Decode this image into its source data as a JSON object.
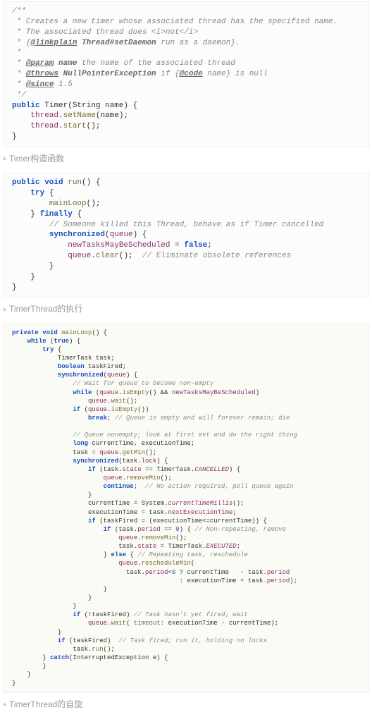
{
  "block1": {
    "jdoc_open": "/**",
    "jdoc_l1": " * Creates a new timer whose associated thread has the specified name.",
    "jdoc_l2_a": " * The associated thread does ",
    "jdoc_l2_b": "<i>",
    "jdoc_l2_c": "not",
    "jdoc_l2_d": "</i>",
    "jdoc_l3_a": " * {",
    "jdoc_l3_tag": "@linkplain",
    "jdoc_l3_ref": " Thread#setDaemon",
    "jdoc_l3_rest": " run as a daemon}.",
    "jdoc_l4": " *",
    "jdoc_l5_a": " * ",
    "jdoc_l5_tag": "@param",
    "jdoc_l5_name": " name",
    "jdoc_l5_rest": " the name of the associated thread",
    "jdoc_l6_a": " * ",
    "jdoc_l6_tag": "@throws",
    "jdoc_l6_name": " NullPointerException",
    "jdoc_l6_rest_a": " if {",
    "jdoc_l6_tag2": "@code",
    "jdoc_l6_rest_b": " name} is null",
    "jdoc_l7_a": " * ",
    "jdoc_l7_tag": "@since",
    "jdoc_l7_rest": " 1.5",
    "jdoc_close": " */",
    "sig_kw": "public",
    "sig_name": " Timer(String name) {",
    "body1_a": "    ",
    "body1_fld": "thread",
    "body1_b": ".",
    "body1_m": "setName",
    "body1_c": "(name);",
    "body2_a": "    ",
    "body2_fld": "thread",
    "body2_b": ".",
    "body2_m": "start",
    "body2_c": "();",
    "close": "}"
  },
  "caption1": "Timer构造函数",
  "block2": {
    "l1_kw1": "public",
    "l1_kw2": " void",
    "l1_name": " run",
    "l1_rest": "() {",
    "l2_kw": "    try",
    "l2_rest": " {",
    "l3_a": "        ",
    "l3_m": "mainLoop",
    "l3_b": "();",
    "l4_a": "    } ",
    "l4_kw": "finally",
    "l4_b": " {",
    "l5_a": "        ",
    "l5_c": "// Someone killed this Thread, behave as if Timer cancelled",
    "l6_a": "        ",
    "l6_kw": "synchronized",
    "l6_b": "(",
    "l6_fld": "queue",
    "l6_c": ") {",
    "l7_a": "            ",
    "l7_fld": "newTasksMayBeScheduled",
    "l7_b": " = ",
    "l7_kw": "false",
    "l7_c": ";",
    "l8_a": "            ",
    "l8_fld": "queue",
    "l8_b": ".",
    "l8_m": "clear",
    "l8_c": "();  ",
    "l8_cmt": "// Eliminate obsolete references",
    "l9": "        }",
    "l10": "    }",
    "l11": "}"
  },
  "caption2": "TimerThread的执行",
  "block3": {
    "l1_kw1": "private",
    "l1_kw2": " void",
    "l1_name": " mainLoop",
    "l1_rest": "() {",
    "l2_kw": "    while",
    "l2_a": " (",
    "l2_kw2": "true",
    "l2_b": ") {",
    "l3_kw": "        try",
    "l3_a": " {",
    "l4": "            TimerTask task;",
    "l5_kw": "            boolean",
    "l5_a": " taskFired;",
    "l6_kw": "            synchronized",
    "l6_a": "(",
    "l6_fld": "queue",
    "l6_b": ") {",
    "l7_a": "                ",
    "l7_c": "// Wait for queue to become non-empty",
    "l8_kw": "                while",
    "l8_a": " (",
    "l8_fld": "queue",
    "l8_b": ".",
    "l8_m": "isEmpty",
    "l8_c": "() && ",
    "l8_fld2": "newTasksMayBeScheduled",
    "l8_d": ")",
    "l9_a": "                    ",
    "l9_fld": "queue",
    "l9_b": ".",
    "l9_m": "wait",
    "l9_c": "();",
    "l10_kw": "                if",
    "l10_a": " (",
    "l10_fld": "queue",
    "l10_b": ".",
    "l10_m": "isEmpty",
    "l10_c": "())",
    "l11_kw": "                    break",
    "l11_a": "; ",
    "l11_c": "// Queue is empty and will forever remain; die",
    "l12": "",
    "l13_a": "                ",
    "l13_c": "// Queue nonempty; look at first evt and do the right thing",
    "l14_kw": "                long",
    "l14_a": " currentTime, executionTime;",
    "l15_a": "                task = ",
    "l15_fld": "queue",
    "l15_b": ".",
    "l15_m": "getMin",
    "l15_c": "();",
    "l16_kw": "                synchronized",
    "l16_a": "(task.",
    "l16_fld": "lock",
    "l16_b": ") {",
    "l17_kw": "                    if",
    "l17_a": " (task.",
    "l17_fld": "state",
    "l17_b": " == TimerTask.",
    "l17_st": "CANCELLED",
    "l17_c": ") {",
    "l18_a": "                        ",
    "l18_fld": "queue",
    "l18_b": ".",
    "l18_m": "removeMin",
    "l18_c": "();",
    "l19_kw": "                        continue",
    "l19_a": ";  ",
    "l19_c": "// No action required, poll queue again",
    "l20": "                    }",
    "l21_a": "                    currentTime = System.",
    "l21_m": "currentTimeMillis",
    "l21_b": "();",
    "l22_a": "                    executionTime = task.",
    "l22_fld": "nextExecutionTime",
    "l22_b": ";",
    "l23_kw": "                    if",
    "l23_a": " (taskFired = (executionTime<=currentTime)) {",
    "l24_kw": "                        if",
    "l24_a": " (task.",
    "l24_fld": "period",
    "l24_b": " == ",
    "l24_n": "0",
    "l24_c": ") { ",
    "l24_cmt": "// Non-repeating, remove",
    "l25_a": "                            ",
    "l25_fld": "queue",
    "l25_b": ".",
    "l25_m": "removeMin",
    "l25_c": "();",
    "l26_a": "                            task.",
    "l26_fld": "state",
    "l26_b": " = TimerTask.",
    "l26_st": "EXECUTED",
    "l26_c": ";",
    "l27_a": "                        } ",
    "l27_kw": "else",
    "l27_b": " { ",
    "l27_c": "// Repeating task, reschedule",
    "l28_a": "                            ",
    "l28_fld": "queue",
    "l28_b": ".",
    "l28_m": "rescheduleMin",
    "l28_c": "(",
    "l29_a": "                              task.",
    "l29_fld": "period",
    "l29_b": "<",
    "l29_n": "0",
    "l29_c": " ? currentTime   - task.",
    "l29_fld2": "period",
    "l30_a": "                                            : executionTime + task.",
    "l30_fld": "period",
    "l30_b": ");",
    "l31": "                        }",
    "l32": "                    }",
    "l33": "                }",
    "l34_kw": "                if",
    "l34_a": " (!taskFired) ",
    "l34_c": "// Task hasn't yet fired; wait",
    "l35_a": "                    ",
    "l35_fld": "queue",
    "l35_b": ".",
    "l35_m": "wait",
    "l35_c": "( ",
    "l35_p": "timeout:",
    "l35_d": " executionTime - currentTime);",
    "l36": "            }",
    "l37_kw": "            if",
    "l37_a": " (taskFired)  ",
    "l37_c": "// Task fired; run it, holding no locks",
    "l38_a": "                task.",
    "l38_m": "run",
    "l38_b": "();",
    "l39_a": "        } ",
    "l39_kw": "catch",
    "l39_b": "(InterruptedException e) {",
    "l40": "        }",
    "l41": "    }",
    "l42": "}"
  },
  "caption3": "TimerThread的自旋"
}
